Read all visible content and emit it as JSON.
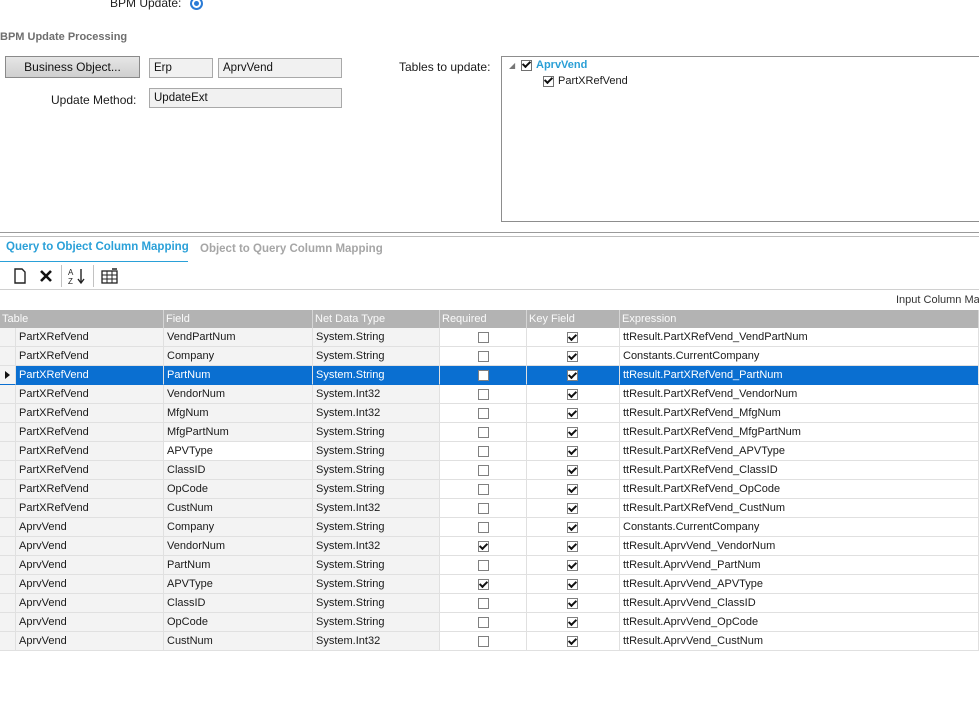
{
  "top": {
    "bpm_update_label": "BPM Update:",
    "section_title": "BPM Update Processing",
    "business_object_button": "Business Object...",
    "erp_value": "Erp",
    "object_value": "AprvVend",
    "update_method_label": "Update Method:",
    "update_method_value": "UpdateExt",
    "tables_label": "Tables to update:"
  },
  "tree": {
    "root": {
      "label": "AprvVend",
      "checked": true
    },
    "children": [
      {
        "label": "PartXRefVend",
        "checked": true
      }
    ]
  },
  "tabs": {
    "active": "Query to Object Column Mapping",
    "inactive": "Object to Query Column Mapping"
  },
  "toolbar": {
    "icons": [
      "new-icon",
      "delete-icon",
      "sort-icon",
      "grid-config-icon"
    ]
  },
  "grid_caption": "Input Column Ma",
  "grid": {
    "headers": [
      "Table",
      "Field",
      "Net Data Type",
      "Required",
      "Key Field",
      "Expression"
    ],
    "selected_row": 2,
    "rows": [
      {
        "table": "PartXRefVend",
        "field": "VendPartNum",
        "type": "System.String",
        "required": false,
        "key": true,
        "expr": "ttResult.PartXRefVend_VendPartNum"
      },
      {
        "table": "PartXRefVend",
        "field": "Company",
        "type": "System.String",
        "required": false,
        "key": true,
        "expr": "Constants.CurrentCompany"
      },
      {
        "table": "PartXRefVend",
        "field": "PartNum",
        "type": "System.String",
        "required": false,
        "key": true,
        "expr": "ttResult.PartXRefVend_PartNum"
      },
      {
        "table": "PartXRefVend",
        "field": "VendorNum",
        "type": "System.Int32",
        "required": false,
        "key": true,
        "expr": "ttResult.PartXRefVend_VendorNum"
      },
      {
        "table": "PartXRefVend",
        "field": "MfgNum",
        "type": "System.Int32",
        "required": false,
        "key": true,
        "expr": "ttResult.PartXRefVend_MfgNum"
      },
      {
        "table": "PartXRefVend",
        "field": "MfgPartNum",
        "type": "System.String",
        "required": false,
        "key": true,
        "expr": "ttResult.PartXRefVend_MfgPartNum"
      },
      {
        "table": "PartXRefVend",
        "field": "APVType",
        "type": "System.String",
        "required": false,
        "key": true,
        "expr": "ttResult.PartXRefVend_APVType"
      },
      {
        "table": "PartXRefVend",
        "field": "ClassID",
        "type": "System.String",
        "required": false,
        "key": true,
        "expr": "ttResult.PartXRefVend_ClassID"
      },
      {
        "table": "PartXRefVend",
        "field": "OpCode",
        "type": "System.String",
        "required": false,
        "key": true,
        "expr": "ttResult.PartXRefVend_OpCode"
      },
      {
        "table": "PartXRefVend",
        "field": "CustNum",
        "type": "System.Int32",
        "required": false,
        "key": true,
        "expr": "ttResult.PartXRefVend_CustNum"
      },
      {
        "table": "AprvVend",
        "field": "Company",
        "type": "System.String",
        "required": false,
        "key": true,
        "expr": "Constants.CurrentCompany"
      },
      {
        "table": "AprvVend",
        "field": "VendorNum",
        "type": "System.Int32",
        "required": true,
        "key": true,
        "expr": "ttResult.AprvVend_VendorNum"
      },
      {
        "table": "AprvVend",
        "field": "PartNum",
        "type": "System.String",
        "required": false,
        "key": true,
        "expr": "ttResult.AprvVend_PartNum"
      },
      {
        "table": "AprvVend",
        "field": "APVType",
        "type": "System.String",
        "required": true,
        "key": true,
        "expr": "ttResult.AprvVend_APVType"
      },
      {
        "table": "AprvVend",
        "field": "ClassID",
        "type": "System.String",
        "required": false,
        "key": true,
        "expr": "ttResult.AprvVend_ClassID"
      },
      {
        "table": "AprvVend",
        "field": "OpCode",
        "type": "System.String",
        "required": false,
        "key": true,
        "expr": "ttResult.AprvVend_OpCode"
      },
      {
        "table": "AprvVend",
        "field": "CustNum",
        "type": "System.Int32",
        "required": false,
        "key": true,
        "expr": "ttResult.AprvVend_CustNum"
      }
    ]
  }
}
